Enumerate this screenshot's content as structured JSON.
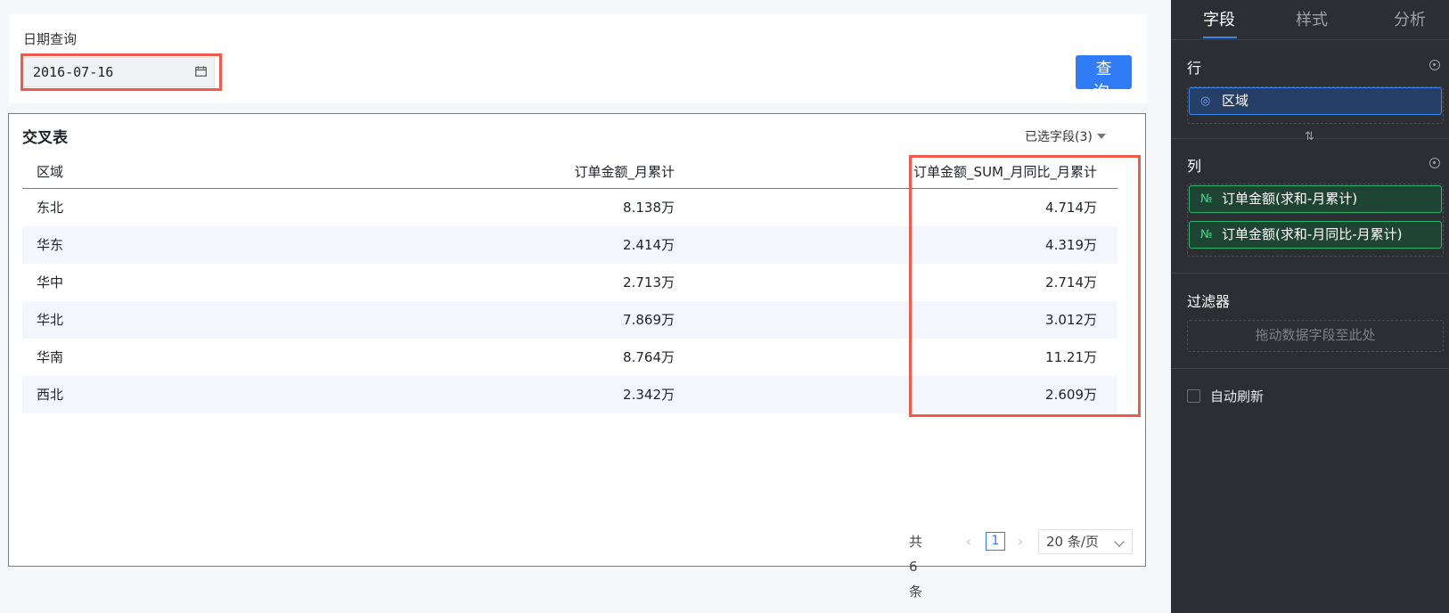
{
  "query": {
    "label": "日期查询",
    "date_value": "2016-07-16",
    "button_label": "查 询"
  },
  "table": {
    "title": "交叉表",
    "fields_selector": "已选字段(3)",
    "columns": [
      "区域",
      "订单金额_月累计",
      "订单金额_SUM_月同比_月累计"
    ],
    "rows": [
      [
        "东北",
        "8.138万",
        "4.714万"
      ],
      [
        "华东",
        "2.414万",
        "4.319万"
      ],
      [
        "华中",
        "2.713万",
        "2.714万"
      ],
      [
        "华北",
        "7.869万",
        "3.012万"
      ],
      [
        "华南",
        "8.764万",
        "11.21万"
      ],
      [
        "西北",
        "2.342万",
        "2.609万"
      ]
    ]
  },
  "pagination": {
    "total": "共 6 条",
    "prev": "‹",
    "current_page": "1",
    "next": "›",
    "page_size": "20 条/页"
  },
  "panel": {
    "tabs": [
      "字段",
      "样式",
      "分析"
    ],
    "active_tab": "字段",
    "rows_section": "行",
    "row_fields": [
      {
        "icon": "location-icon",
        "glyph": "◎",
        "label": "区域"
      }
    ],
    "swap_glyph": "⇅",
    "columns_section": "列",
    "column_fields": [
      {
        "icon": "number-icon",
        "glyph": "№",
        "label": "订单金额(求和-月累计)"
      },
      {
        "icon": "number-icon",
        "glyph": "№",
        "label": "订单金额(求和-月同比-月累计)"
      }
    ],
    "filter_section": "过滤器",
    "filter_hint": "拖动数据字段至此处",
    "auto_refresh": "自动刷新"
  },
  "colors": {
    "accent": "#2f7cf6",
    "highlight": "#f1594b",
    "panel_bg": "#2c2e33"
  }
}
